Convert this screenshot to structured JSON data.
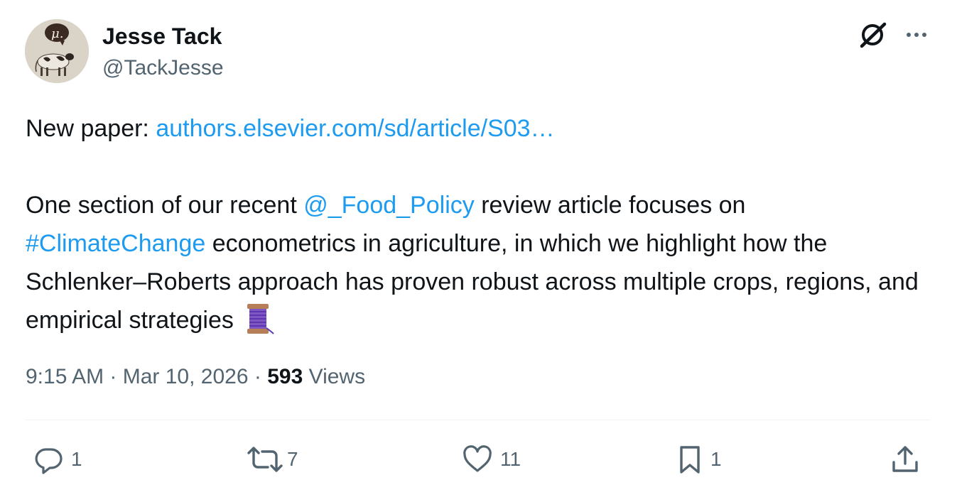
{
  "author": {
    "name": "Jesse Tack",
    "handle": "@TackJesse"
  },
  "tweet": {
    "line1_prefix": "New paper: ",
    "line1_link": "authors.elsevier.com/sd/article/S03…",
    "p2_a": "One section of our recent ",
    "p2_mention": "@_Food_Policy",
    "p2_b": " review article focuses on",
    "p2_hashtag": "#ClimateChange",
    "p2_c": " econometrics in agriculture, in which we highlight how the Schlenker–Roberts approach has proven robust across multiple crops, regions, and empirical strategies"
  },
  "meta": {
    "time": "9:15 AM",
    "sep": " · ",
    "date": "Mar 10, 2026",
    "sep2": " · ",
    "views_count": "593",
    "views_label": " Views"
  },
  "actions": {
    "replies": "1",
    "reposts": "7",
    "likes": "11",
    "bookmarks": "1"
  },
  "colors": {
    "link": "#1d9bf0",
    "secondary": "#536471",
    "text": "#0f1419"
  }
}
